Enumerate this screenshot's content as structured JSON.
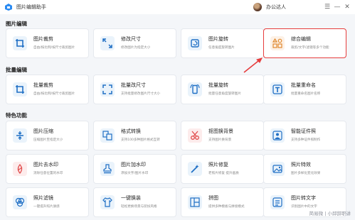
{
  "titlebar": {
    "app_title": "图片编辑助手",
    "user_name": "办公达人",
    "controls": [
      "☰",
      "—",
      "✕"
    ]
  },
  "sections": {
    "edit": "图片编辑",
    "batch": "批量编辑",
    "special": "特色功能"
  },
  "edit_cards": [
    {
      "title": "图片裁剪",
      "desc": "自由/按比例/按尺寸裁剪图片",
      "icon": "crop-icon"
    },
    {
      "title": "修改尺寸",
      "desc": "修改图片为指定大小",
      "icon": "resize-icon"
    },
    {
      "title": "图片旋转",
      "desc": "任意角度旋转图片",
      "icon": "rotate-icon"
    },
    {
      "title": "综合编辑",
      "desc": "裁剪/文字/滤镜等多个功能",
      "icon": "grid-edit-icon"
    }
  ],
  "batch_cards": [
    {
      "title": "批量裁剪",
      "desc": "自由/按比例/按尺寸裁剪图片",
      "icon": "crop-icon"
    },
    {
      "title": "批量改尺寸",
      "desc": "支持批量修改图片尺寸大小",
      "icon": "resize-icon"
    },
    {
      "title": "批量旋转",
      "desc": "批量任意角度旋转图片",
      "icon": "rotate-icon"
    },
    {
      "title": "批量重命名",
      "desc": "批量重命名图片名称",
      "icon": "text-t-icon"
    }
  ],
  "special_cards": [
    {
      "title": "图片压缩",
      "desc": "压缩图片至指定大小",
      "icon": "compress-icon"
    },
    {
      "title": "格式转换",
      "desc": "支持100多种图片格式互转",
      "icon": "convert-icon"
    },
    {
      "title": "抠图换背景",
      "desc": "支持图片换背景",
      "icon": "cutout-icon"
    },
    {
      "title": "智能证件照",
      "desc": "支持多种证件照制作",
      "icon": "id-photo-icon"
    },
    {
      "title": "图片去水印",
      "desc": "消除任意位置的水印",
      "icon": "eraser-icon"
    },
    {
      "title": "图片加水印",
      "desc": "添加文字/图片水印",
      "icon": "stamp-icon"
    },
    {
      "title": "照片修复",
      "desc": "老照片修复 提升画质",
      "icon": "magic-wand-icon"
    },
    {
      "title": "照片特效",
      "desc": "图片多样化变化效果",
      "icon": "image-effect-icon"
    },
    {
      "title": "照片滤镜",
      "desc": "一键提升照片质感",
      "icon": "filter-icon"
    },
    {
      "title": "一键换装",
      "desc": "轻松更换场景与装扮风格",
      "icon": "clothes-icon"
    },
    {
      "title": "拼图",
      "desc": "提供多种模板与拼接模式",
      "icon": "collage-icon"
    },
    {
      "title": "图片转文字",
      "desc": "识别图片中的文字",
      "icon": "ocr-icon"
    }
  ],
  "watermark": "简易微 | 小邱辞职讲",
  "colors": {
    "accent": "#1f6fc5",
    "highlight": "#e63d3d"
  }
}
